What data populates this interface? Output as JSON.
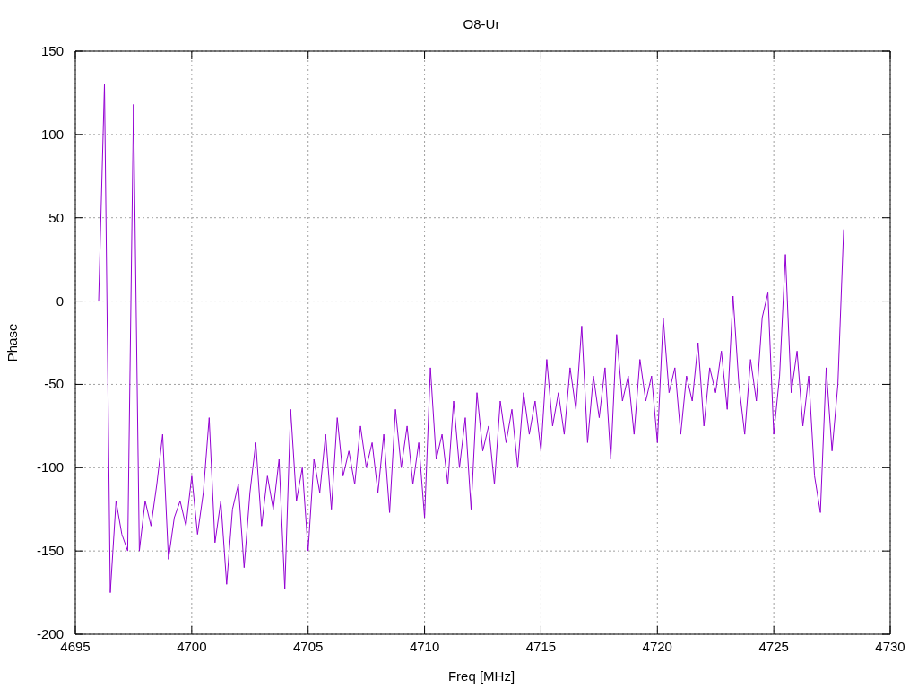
{
  "chart_data": {
    "type": "line",
    "grid": true,
    "title": "O8-Ur",
    "xlabel": "Freq [MHz]",
    "ylabel": "Phase",
    "xlim": [
      4695,
      4730
    ],
    "ylim": [
      -200,
      150
    ],
    "xticks": [
      4695,
      4700,
      4705,
      4710,
      4715,
      4720,
      4725,
      4730
    ],
    "yticks": [
      -200,
      -150,
      -100,
      -50,
      0,
      50,
      100,
      150
    ],
    "x": [
      4696,
      4696.25,
      4696.5,
      4696.75,
      4697,
      4697.25,
      4697.5,
      4697.75,
      4698,
      4698.25,
      4698.5,
      4698.75,
      4699,
      4699.25,
      4699.5,
      4699.75,
      4700,
      4700.25,
      4700.5,
      4700.75,
      4701,
      4701.25,
      4701.5,
      4701.75,
      4702,
      4702.25,
      4702.5,
      4702.75,
      4703,
      4703.25,
      4703.5,
      4703.75,
      4704,
      4704.25,
      4704.5,
      4704.75,
      4705,
      4705.25,
      4705.5,
      4705.75,
      4706,
      4706.25,
      4706.5,
      4706.75,
      4707,
      4707.25,
      4707.5,
      4707.75,
      4708,
      4708.25,
      4708.5,
      4708.75,
      4709,
      4709.25,
      4709.5,
      4709.75,
      4710,
      4710.25,
      4710.5,
      4710.75,
      4711,
      4711.25,
      4711.5,
      4711.75,
      4712,
      4712.25,
      4712.5,
      4712.75,
      4713,
      4713.25,
      4713.5,
      4713.75,
      4714,
      4714.25,
      4714.5,
      4714.75,
      4715,
      4715.25,
      4715.5,
      4715.75,
      4716,
      4716.25,
      4716.5,
      4716.75,
      4717,
      4717.25,
      4717.5,
      4717.75,
      4718,
      4718.25,
      4718.5,
      4718.75,
      4719,
      4719.25,
      4719.5,
      4719.75,
      4720,
      4720.25,
      4720.5,
      4720.75,
      4721,
      4721.25,
      4721.5,
      4721.75,
      4722,
      4722.25,
      4722.5,
      4722.75,
      4723,
      4723.25,
      4723.5,
      4723.75,
      4724,
      4724.25,
      4724.5,
      4724.75,
      4725,
      4725.25,
      4725.5,
      4725.75,
      4726,
      4726.25,
      4726.5,
      4726.75,
      4727,
      4727.25,
      4727.5,
      4727.75,
      4728
    ],
    "series": [
      {
        "color": "#9400d3",
        "values": [
          0,
          130,
          -175,
          -120,
          -140,
          -150,
          118,
          -150,
          -120,
          -135,
          -110,
          -80,
          -155,
          -130,
          -120,
          -135,
          -105,
          -140,
          -115,
          -70,
          -145,
          -120,
          -170,
          -125,
          -110,
          -160,
          -115,
          -85,
          -135,
          -105,
          -125,
          -95,
          -173,
          -65,
          -120,
          -100,
          -150,
          -95,
          -115,
          -80,
          -125,
          -70,
          -105,
          -90,
          -110,
          -75,
          -100,
          -85,
          -115,
          -80,
          -127,
          -65,
          -100,
          -75,
          -110,
          -85,
          -130,
          -40,
          -95,
          -80,
          -110,
          -60,
          -100,
          -70,
          -125,
          -55,
          -90,
          -75,
          -110,
          -60,
          -85,
          -65,
          -100,
          -55,
          -80,
          -60,
          -90,
          -35,
          -75,
          -55,
          -80,
          -40,
          -65,
          -15,
          -85,
          -45,
          -70,
          -40,
          -95,
          -20,
          -60,
          -45,
          -80,
          -35,
          -60,
          -45,
          -85,
          -10,
          -55,
          -40,
          -80,
          -45,
          -60,
          -25,
          -75,
          -40,
          -55,
          -30,
          -65,
          3,
          -50,
          -80,
          -35,
          -60,
          -10,
          5,
          -80,
          -45,
          28,
          -55,
          -30,
          -75,
          -45,
          -105,
          -127,
          -40,
          -90,
          -50,
          43
        ]
      }
    ]
  }
}
